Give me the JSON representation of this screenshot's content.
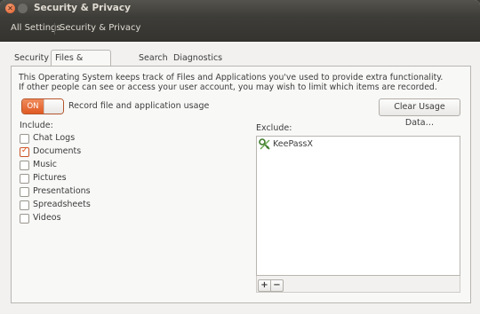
{
  "window": {
    "title": "Security & Privacy"
  },
  "toolbar": {
    "all_settings": "All Settings",
    "breadcrumb": "Security & Privacy"
  },
  "tabs": [
    {
      "label": "Security"
    },
    {
      "label": "Files & Applications",
      "active": true
    },
    {
      "label": "Search"
    },
    {
      "label": "Diagnostics"
    }
  ],
  "panel": {
    "description": "This Operating System keeps track of Files and Applications you've used to provide extra functionality. If other people can see or access your user account, you may wish to limit which items are recorded.",
    "toggle": {
      "state": "ON",
      "label": "Record file and application usage"
    },
    "clear_button": "Clear Usage Data…",
    "include": {
      "label": "Include:",
      "items": [
        {
          "label": "Chat Logs",
          "checked": false
        },
        {
          "label": "Documents",
          "checked": true
        },
        {
          "label": "Music",
          "checked": false
        },
        {
          "label": "Pictures",
          "checked": false
        },
        {
          "label": "Presentations",
          "checked": false
        },
        {
          "label": "Spreadsheets",
          "checked": false
        },
        {
          "label": "Videos",
          "checked": false
        }
      ]
    },
    "exclude": {
      "label": "Exclude:",
      "items": [
        {
          "label": "KeePassX",
          "icon": "keepassx-icon"
        }
      ],
      "add_label": "+",
      "remove_label": "−"
    }
  },
  "colors": {
    "accent": "#e05a24",
    "titlebar": "#3c3b37",
    "window_bg": "#f2f1f0"
  }
}
